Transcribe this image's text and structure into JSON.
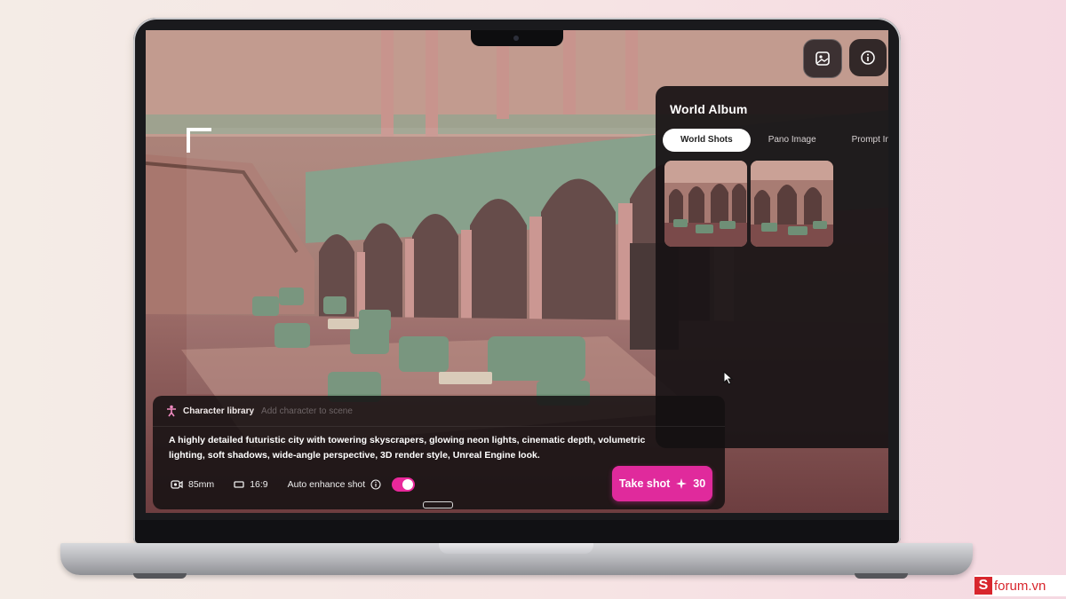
{
  "album": {
    "title": "World Album",
    "tabs": [
      "World Shots",
      "Pano Image",
      "Prompt Im"
    ]
  },
  "prompt_bar": {
    "character_label": "Character library",
    "character_placeholder": "Add character to scene",
    "prompt": "A highly detailed futuristic city with towering skyscrapers, glowing neon lights, cinematic depth, volumetric lighting, soft shadows, wide-angle perspective, 3D render style, Unreal Engine look.",
    "lens": "85mm",
    "aspect": "16:9",
    "auto_enhance_label": "Auto enhance shot",
    "auto_enhance_on": true,
    "take_shot_label": "Take shot",
    "credits": "30"
  },
  "watermark": {
    "letter": "S",
    "text": "forum.vn"
  },
  "colors": {
    "accent": "#e02a9c",
    "panel": "#1a1416",
    "watermark": "#d8262d"
  },
  "icons": [
    "album-icon",
    "info-icon",
    "character-icon",
    "camera-lens-icon",
    "aspect-ratio-icon",
    "info-circle-icon",
    "sparkle-icon",
    "cursor-icon"
  ]
}
